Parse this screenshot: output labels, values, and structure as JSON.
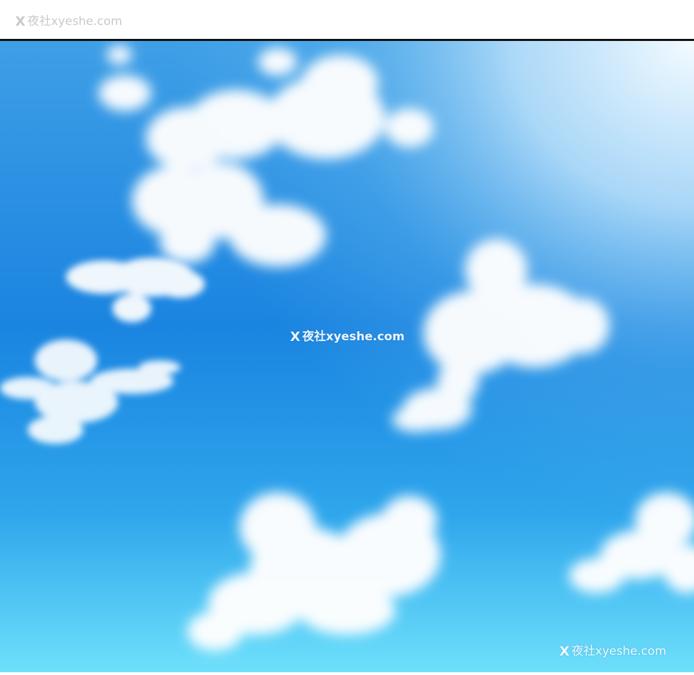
{
  "watermarks": [
    {
      "glyph": "X",
      "text": "夜社xyeshe.com"
    },
    {
      "glyph": "X",
      "text": "夜社xyeshe.com"
    },
    {
      "glyph": "X",
      "text": "夜社xyeshe.com"
    }
  ],
  "colors": {
    "sky_top_right": "#f4fbff",
    "sky_mid": "#1a84e0",
    "sky_bottom": "#6ee0fb",
    "cloud": "#ffffff",
    "panel_border": "#111111",
    "page_background": "#ffffff"
  }
}
